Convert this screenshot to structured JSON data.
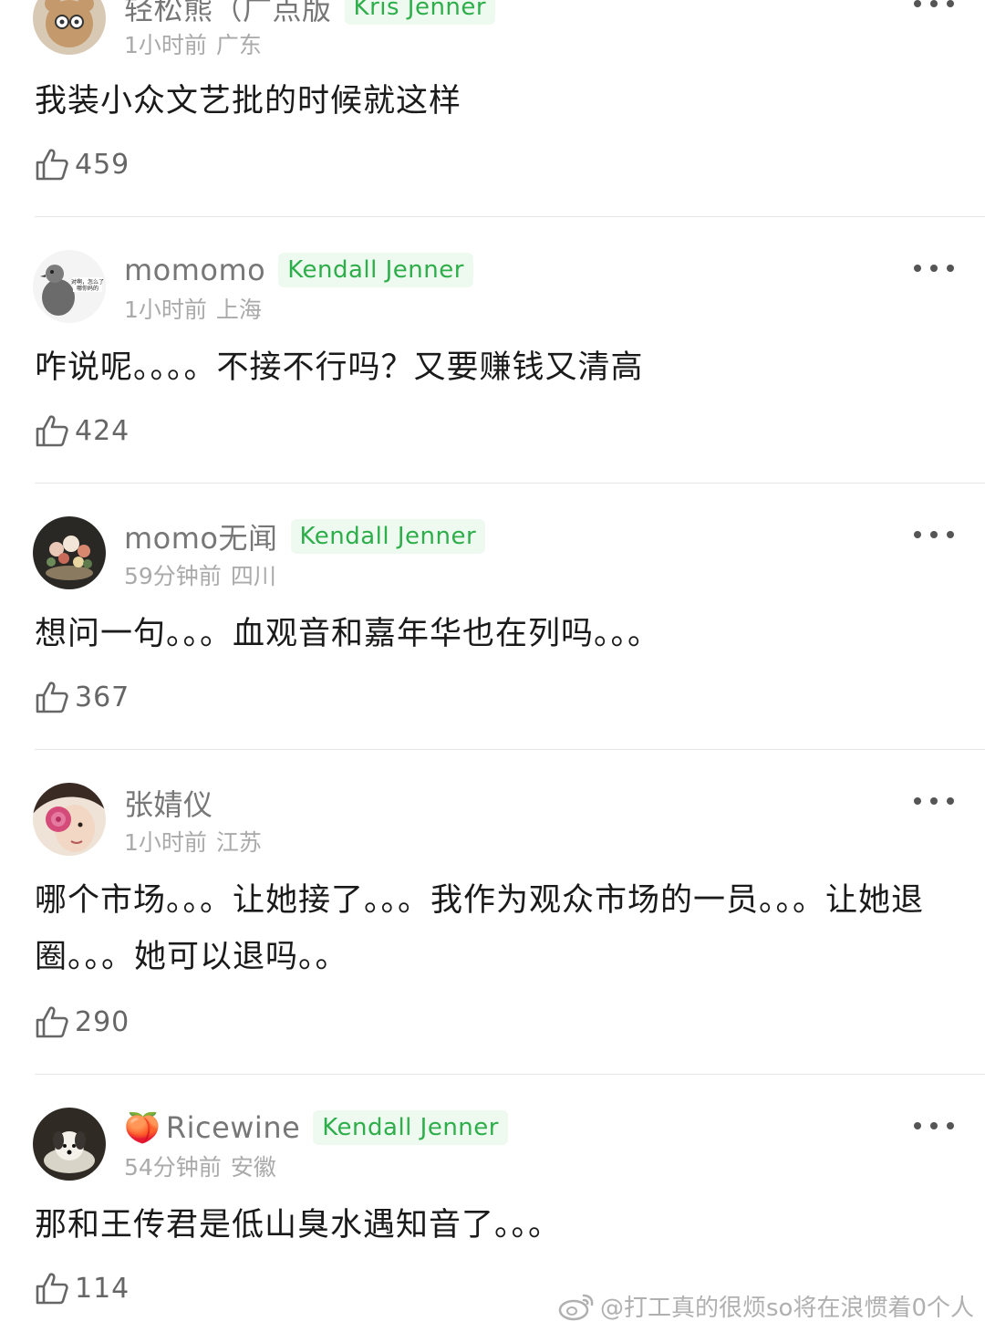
{
  "comments": [
    {
      "username": "轻松熊（广点版",
      "badge": "Kris Jenner",
      "time": "1小时前",
      "location": "广东",
      "text": "我装小众文艺批的时候就这样",
      "likes": "459",
      "avatar_icon": "bear-avatar",
      "colors": {
        "bg": "#c7b39a",
        "fg": "#7a6a9a"
      }
    },
    {
      "username": "momomo",
      "badge": "Kendall Jenner",
      "time": "1小时前",
      "location": "上海",
      "text": "咋说呢。。。。不接不行吗？又要赚钱又清高",
      "likes": "424",
      "avatar_icon": "pigeon-avatar",
      "avatar_caption": "对啊，怎么了 哪你妈的",
      "colors": {
        "bg": "#f2f2f2",
        "fg": "#555555"
      }
    },
    {
      "username": "momo无闻",
      "badge": "Kendall Jenner",
      "time": "59分钟前",
      "location": "四川",
      "text": "想问一句。。。血观音和嘉年华也在列吗。。。",
      "likes": "367",
      "avatar_icon": "flower-painting-avatar",
      "colors": {
        "bg": "#2b2a26",
        "fg": "#d9b7a0"
      }
    },
    {
      "username": "张婧仪",
      "badge": "",
      "time": "1小时前",
      "location": "江苏",
      "text": "哪个市场。。。让她接了。。。我作为观众市场的一员。。。让她退圈。。。她可以退吗。。",
      "likes": "290",
      "avatar_icon": "portrait-avatar",
      "colors": {
        "bg": "#e8d2c4",
        "fg": "#c9406a"
      }
    },
    {
      "username": "Ricewine",
      "name_emoji": "🍑",
      "badge": "Kendall Jenner",
      "time": "54分钟前",
      "location": "安徽",
      "text": "那和王传君是低山臭水遇知音了。。。",
      "likes": "114",
      "avatar_icon": "dog-avatar",
      "colors": {
        "bg": "#2f2b24",
        "fg": "#f4f1ea"
      }
    }
  ],
  "watermark": "@打工真的很烦so将在浪惯着0个人",
  "icons": {
    "like": "thumbs-up-icon",
    "more": "more-dots-icon",
    "weibo": "weibo-logo-icon"
  },
  "colors": {
    "badge_text": "#2eae4a",
    "badge_bg": "#eefaf0",
    "meta": "#aaaaaa",
    "divider": "#e6e6e6"
  }
}
